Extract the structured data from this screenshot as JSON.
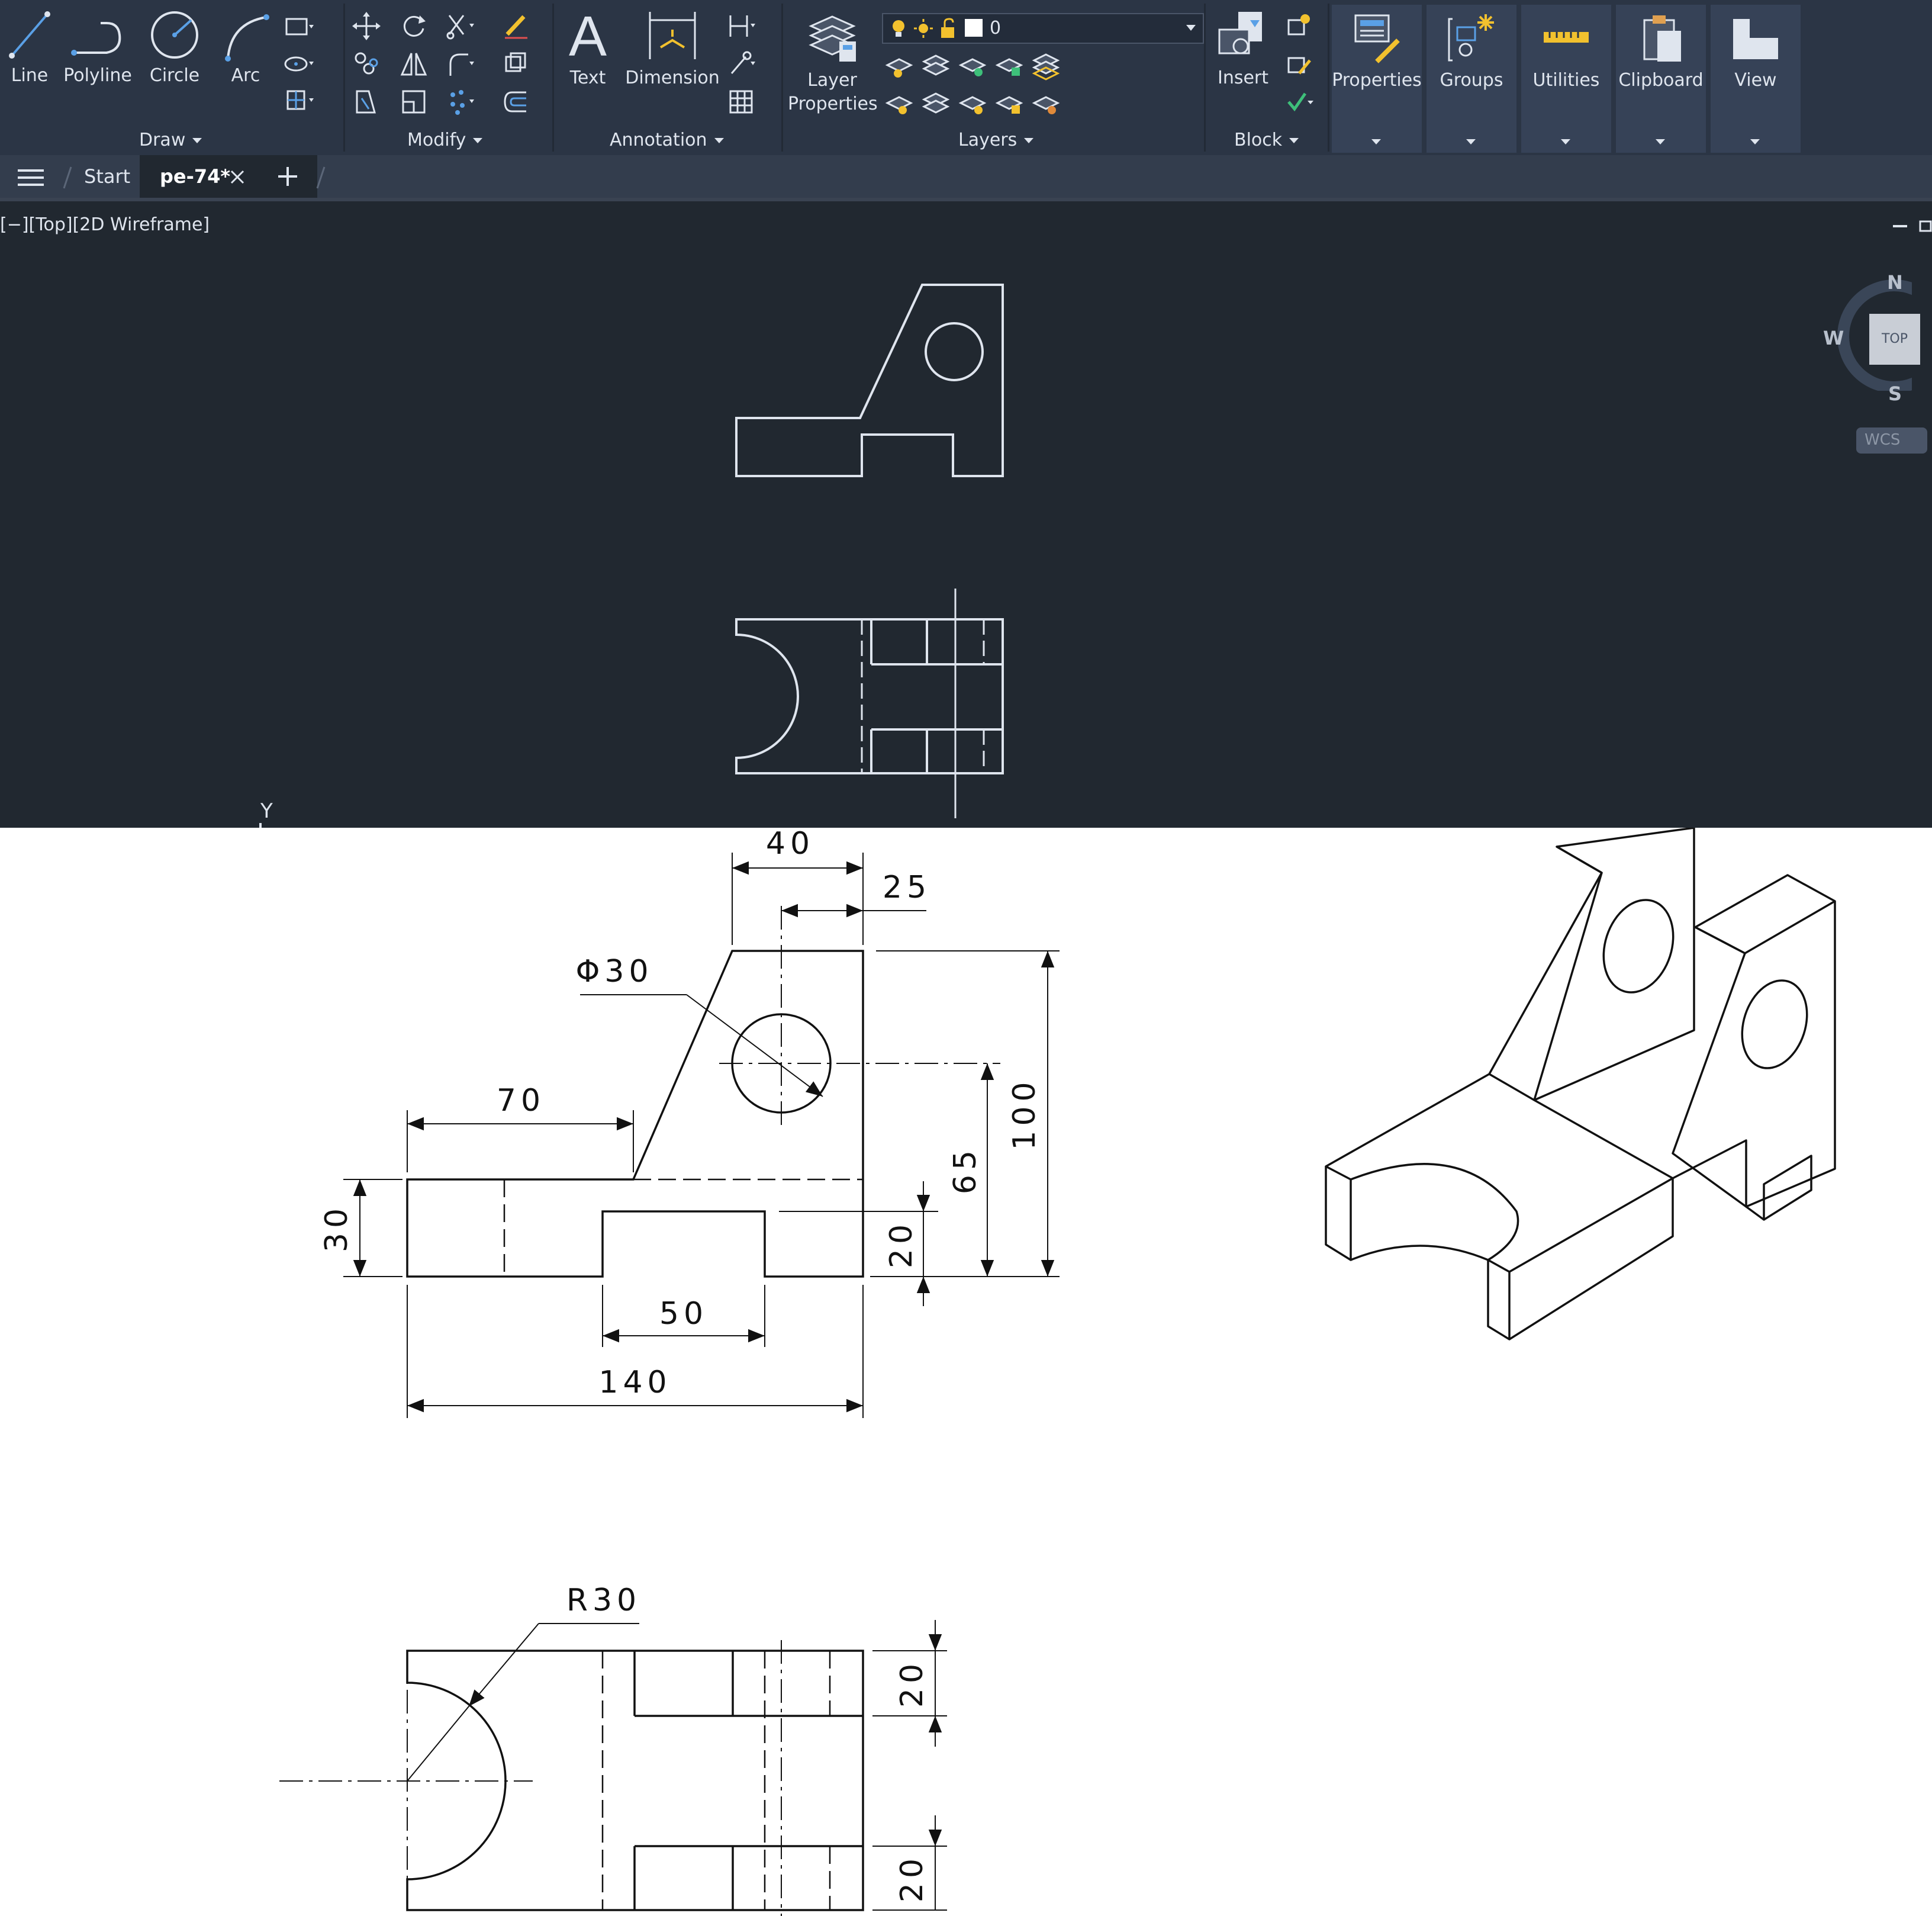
{
  "ribbon": {
    "draw": {
      "label": "Draw",
      "tools": [
        "Line",
        "Polyline",
        "Circle",
        "Arc"
      ]
    },
    "modify": {
      "label": "Modify"
    },
    "annotation": {
      "label": "Annotation",
      "tools": [
        "Text",
        "Dimension"
      ]
    },
    "layers": {
      "label": "Layers",
      "layer_properties_line1": "Layer",
      "layer_properties_line2": "Properties",
      "current_layer": "0"
    },
    "block": {
      "label": "Block",
      "insert": "Insert"
    },
    "big_buttons": [
      "Properties",
      "Groups",
      "Utilities",
      "Clipboard",
      "View"
    ]
  },
  "tabs": {
    "start": "Start",
    "active": "pe-74*"
  },
  "viewport": {
    "label": "[−][Top][2D Wireframe]",
    "viewcube": {
      "n": "N",
      "w": "W",
      "s": "S",
      "face": "TOP",
      "wcs": "WCS"
    },
    "ucs_y": "Y"
  },
  "drawing": {
    "front_dims": [
      "40",
      "25",
      "Φ30",
      "70",
      "100",
      "65",
      "30",
      "20",
      "50",
      "140"
    ],
    "top_dims": [
      "R30",
      "20",
      "20"
    ]
  },
  "colors": {
    "ribbon_bg": "#2b3545",
    "viewport_bg": "#212830",
    "line": "#dfe5ee",
    "accent_yellow": "#f2c12e"
  }
}
